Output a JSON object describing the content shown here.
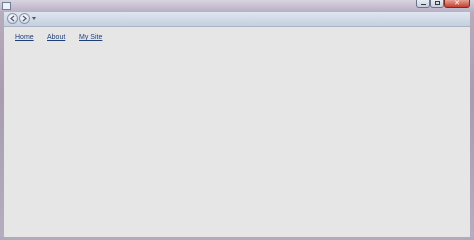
{
  "window": {
    "controls": {
      "minimize_icon": "minimize-icon",
      "maximize_icon": "maximize-icon",
      "close_label": "✕"
    }
  },
  "navigation": {
    "back_icon": "back-arrow-icon",
    "forward_icon": "forward-arrow-icon",
    "dropdown_icon": "chevron-down-icon"
  },
  "page": {
    "links": [
      {
        "label": "Home"
      },
      {
        "label": "About"
      },
      {
        "label": "My Site"
      }
    ]
  },
  "colors": {
    "link": "#1f3f7a",
    "content_background": "#e6e6e6",
    "close_button": "#c2402e"
  }
}
